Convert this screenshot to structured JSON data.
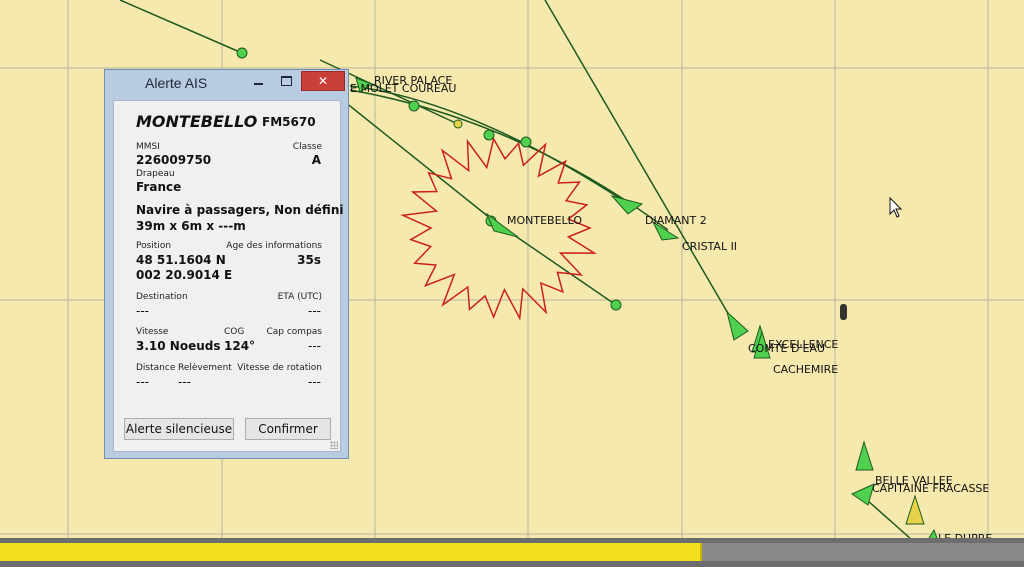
{
  "colors": {
    "sea": "#f5e9ae",
    "grid": "#b8b8a4",
    "track": "#1e5a1e",
    "vessel_green": "#4fd04f",
    "vessel_yellow": "#e6d34a",
    "danger_ring": "#cc1f1f"
  },
  "chart": {
    "vessel_labels": [
      "RIVER PALACE",
      "E MOLET COUREAU",
      "MONTEBELLO",
      "DIAMANT 2",
      "CRISTAL II",
      "EXCELLENCE",
      "COMTE D'EAU",
      "CACHEMIRE",
      "BELLE VALLEE",
      "CAPITAINE FRACASSE",
      "LE DUPRE"
    ]
  },
  "dialog": {
    "title": "Alerte AIS",
    "minimize_icon": "minimize-icon",
    "maximize_icon": "maximize-icon",
    "close_icon": "close-icon",
    "close_glyph": "✕",
    "vessel_name": "MONTEBELLO",
    "callsign": "FM5670",
    "mmsi_label": "MMSI",
    "mmsi": "226009750",
    "class_label": "Classe",
    "class": "A",
    "flag_label": "Drapeau",
    "flag": "France",
    "vessel_type": "Navire à passagers, Non défini",
    "dimensions": "39m x 6m x ---m",
    "position_label": "Position",
    "latitude": "48 51.1604 N",
    "longitude": "002 20.9014 E",
    "age_label": "Age des informations",
    "age": "35s",
    "destination_label": "Destination",
    "destination": "---",
    "eta_label": "ETA (UTC)",
    "eta": "---",
    "speed_label": "Vitesse",
    "speed": "3.10 Noeuds",
    "cog_label": "COG",
    "cog": "124°",
    "heading_label": "Cap compas",
    "heading": "---",
    "distance_label": "Distance",
    "distance": "---",
    "bearing_label": "Relèvement",
    "bearing": "---",
    "rot_label": "Vitesse de rotation",
    "rot": "---",
    "silence_button": "Alerte silencieuse",
    "confirm_button": "Confirmer"
  },
  "progress": {
    "fraction": 0.686
  }
}
